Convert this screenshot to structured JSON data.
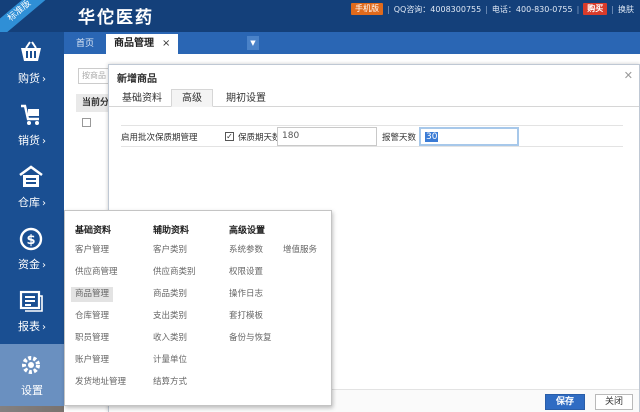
{
  "header": {
    "ribbon": "标准版",
    "logo": "华佗医药",
    "mobile_label": "手机版",
    "qq_label": "QQ咨询：4008300755",
    "phone_label": "电话：400-830-0755",
    "buy_label": "购买",
    "switch_skin_label": "换肤"
  },
  "nav": {
    "items": [
      {
        "label": "购货",
        "icon": "basket-icon"
      },
      {
        "label": "销货",
        "icon": "cart-icon"
      },
      {
        "label": "仓库",
        "icon": "warehouse-icon"
      },
      {
        "label": "资金",
        "icon": "dollar-icon"
      },
      {
        "label": "报表",
        "icon": "report-icon"
      },
      {
        "label": "设置",
        "icon": "gear-icon"
      }
    ]
  },
  "tabs": {
    "home": "首页",
    "active": "商品管理",
    "close": "×"
  },
  "background": {
    "search_placeholder": "按商品",
    "col_header": "当前分"
  },
  "dialog": {
    "title": "新增商品",
    "tabs": [
      "基础资料",
      "高级",
      "期初设置"
    ],
    "adv": {
      "batch_label": "启用批次保质期管理",
      "shelf_label": "保质期天数",
      "shelf_value": "180",
      "alarm_label": "报警天数",
      "alarm_value": "30"
    },
    "save": "保存",
    "close_btn": "关闭"
  },
  "menu": {
    "col1": {
      "title": "基础资料",
      "items": [
        "客户管理",
        "供应商管理",
        "商品管理",
        "仓库管理",
        "职员管理",
        "账户管理",
        "发货地址管理"
      ]
    },
    "col2": {
      "title": "辅助资料",
      "items": [
        "客户类别",
        "供应商类别",
        "商品类别",
        "支出类别",
        "收入类别",
        "计量单位",
        "结算方式"
      ]
    },
    "col3": {
      "title": "高级设置",
      "items": [
        "系统参数",
        "权限设置",
        "操作日志",
        "套打模板",
        "备份与恢复"
      ],
      "extra": "增值服务"
    }
  },
  "colors": {
    "header_bg": "#14407a",
    "nav_bg": "#1a4f92",
    "tabbar_bg": "#2a66b4",
    "primary_btn": "#2f6cc3",
    "badge_orange": "#e06a1c",
    "badge_red": "#d93b2b"
  }
}
